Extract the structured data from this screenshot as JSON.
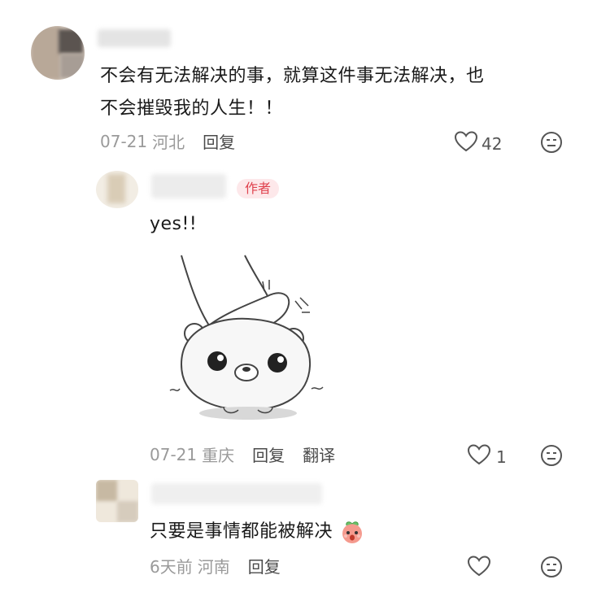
{
  "comments": [
    {
      "text_line1": "不会有无法解决的事，就算这件事无法解决，也",
      "text_line2": "不会摧毁我的人生！！",
      "date": "07-21",
      "region": "河北",
      "reply_label": "回复",
      "likes": "42"
    },
    {
      "author_badge": "作者",
      "text": "yes!!",
      "sticker": "bear-being-patted-sticker",
      "date": "07-21",
      "region": "重庆",
      "reply_label": "回复",
      "translate_label": "翻译",
      "likes": "1"
    },
    {
      "text": "只要是事情都能被解决",
      "emoji": "peach-face-emoji",
      "date": "6天前",
      "region": "河南",
      "reply_label": "回复",
      "likes": ""
    }
  ],
  "icons": {
    "like": "heart-icon",
    "dislike": "dislike-face-icon"
  },
  "colors": {
    "author_badge_text": "#e0434f",
    "author_badge_bg": "#fde8ea",
    "meta_gray": "#9a9a9a"
  }
}
